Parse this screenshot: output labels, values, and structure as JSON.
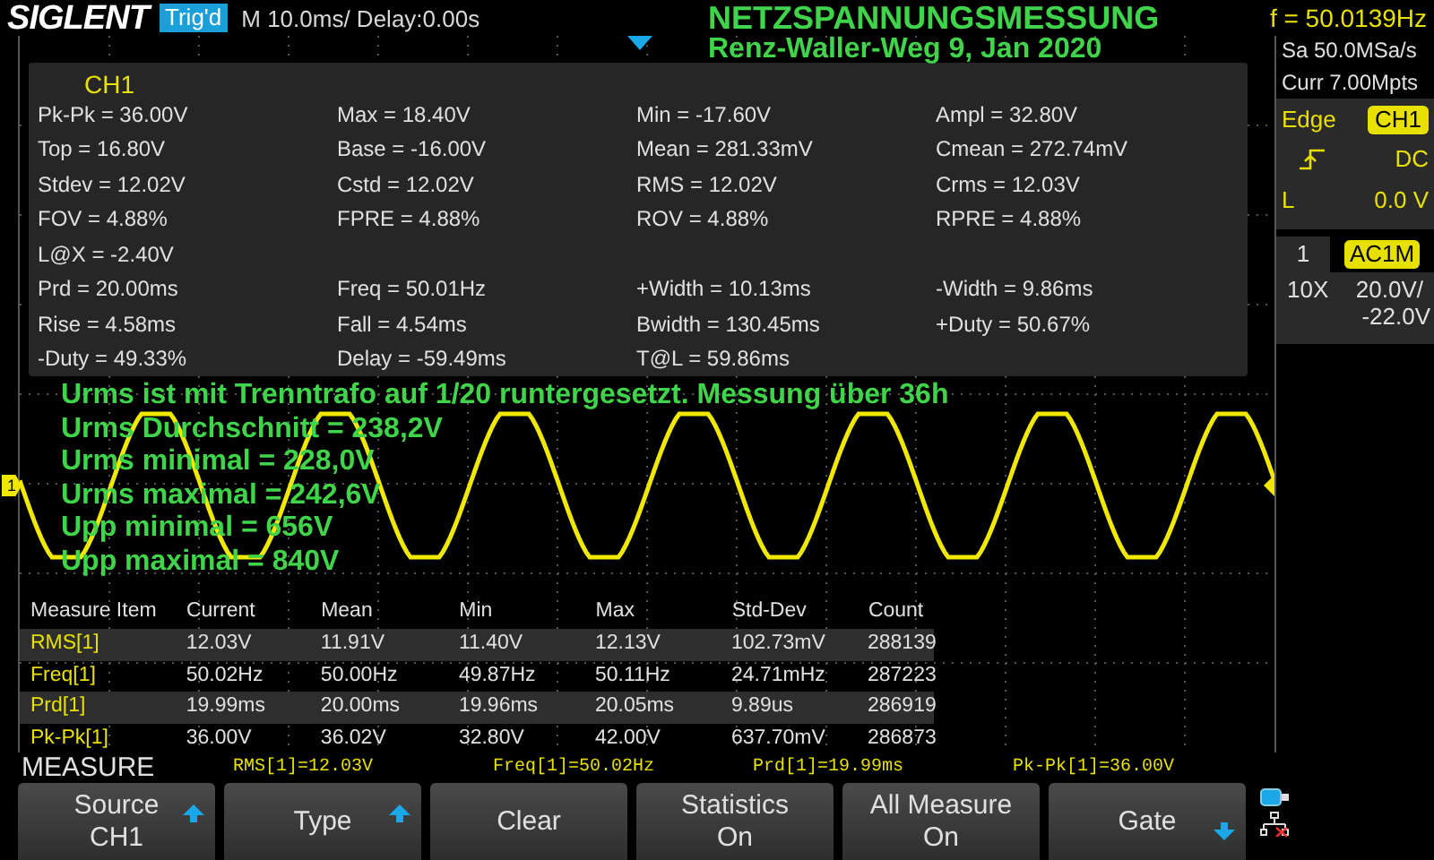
{
  "top_bar": {
    "brand": "SIGLENT",
    "trigger_status": "Trig'd",
    "timebase": "M 10.0ms/ Delay:0.00s",
    "frequency": "f = 50.0139Hz"
  },
  "title": "NETZSPANNUNGSMESSUNG",
  "subtitle": "Renz-Waller-Weg 9, Jan 2020",
  "measure_panel": {
    "channel": "CH1",
    "rows": [
      [
        "Pk-Pk = 36.00V",
        "Max = 18.40V",
        "Min = -17.60V",
        "Ampl = 32.80V"
      ],
      [
        "Top = 16.80V",
        "Base = -16.00V",
        "Mean = 281.33mV",
        "Cmean = 272.74mV"
      ],
      [
        "Stdev = 12.02V",
        "Cstd = 12.02V",
        "RMS = 12.02V",
        "Crms = 12.03V"
      ],
      [
        "FOV = 4.88%",
        "FPRE = 4.88%",
        "ROV = 4.88%",
        "RPRE = 4.88%"
      ],
      [
        "L@X = -2.40V"
      ],
      [
        "Prd = 20.00ms",
        "Freq = 50.01Hz",
        "+Width = 10.13ms",
        "-Width = 9.86ms"
      ],
      [
        "Rise = 4.58ms",
        "Fall = 4.54ms",
        "Bwidth = 130.45ms",
        "+Duty = 50.67%"
      ],
      [
        "-Duty = 49.33%",
        "Delay = -59.49ms",
        "T@L = 59.86ms"
      ]
    ]
  },
  "notes": [
    "Urms ist mit Trenntrafo auf 1/20 runtergesetzt. Messung über 36h",
    "Urms Durchschnitt = 238,2V",
    "Urms minimal = 228,0V",
    "Urms maximal = 242,6V",
    "Upp minimal = 656V",
    "Upp maximal = 840V"
  ],
  "channel_marker": "1",
  "statistics": {
    "columns": [
      "Measure Item",
      "Current",
      "Mean",
      "Min",
      "Max",
      "Std-Dev",
      "Count"
    ],
    "rows": [
      [
        "RMS[1]",
        "12.03V",
        "11.91V",
        "11.40V",
        "12.13V",
        "102.73mV",
        "288139"
      ],
      [
        "Freq[1]",
        "50.02Hz",
        "50.00Hz",
        "49.87Hz",
        "50.11Hz",
        "24.71mHz",
        "287223"
      ],
      [
        "Prd[1]",
        "19.99ms",
        "20.00ms",
        "19.96ms",
        "20.05ms",
        "9.89us",
        "286919"
      ],
      [
        "Pk-Pk[1]",
        "36.00V",
        "36.02V",
        "32.80V",
        "42.00V",
        "637.70mV",
        "286873"
      ]
    ]
  },
  "right_panel": {
    "sample_rate": "Sa 50.0MSa/s",
    "memory_depth": "Curr 7.00Mpts",
    "trigger_type": "Edge",
    "trigger_source": "CH1",
    "trigger_coupling": "DC",
    "level_label": "L",
    "level_value": "0.0 V",
    "channel_tab": "1",
    "channel_coupling": "AC1M",
    "probe": "10X",
    "scale": "20.0V/",
    "offset": "-22.0V"
  },
  "measure_bar": {
    "label": "MEASURE",
    "readings": [
      "RMS[1]=12.03V",
      "Freq[1]=50.02Hz",
      "Prd[1]=19.99ms",
      "Pk-Pk[1]=36.00V"
    ]
  },
  "softkeys": [
    {
      "lines": [
        "Source",
        "CH1"
      ],
      "kind": "up"
    },
    {
      "lines": [
        "Type"
      ],
      "kind": "up"
    },
    {
      "lines": [
        "Clear"
      ],
      "kind": "plain"
    },
    {
      "lines": [
        "Statistics",
        "On"
      ],
      "kind": "plain"
    },
    {
      "lines": [
        "All Measure",
        "On"
      ],
      "kind": "plain"
    },
    {
      "lines": [
        "Gate"
      ],
      "kind": "down"
    }
  ]
}
